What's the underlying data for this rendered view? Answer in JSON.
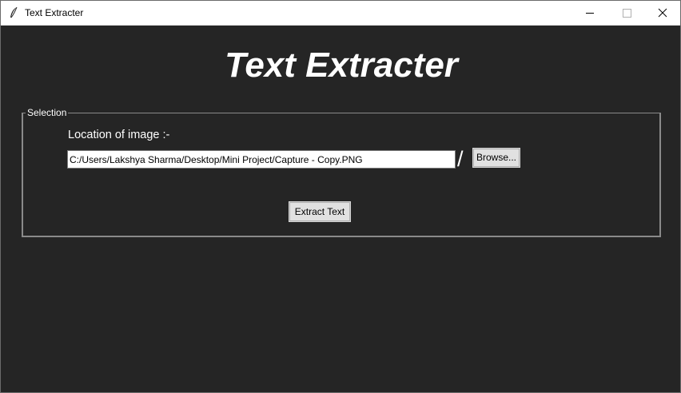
{
  "window": {
    "title": "Text Extracter",
    "icon": "feather-icon"
  },
  "heading": "Text Extracter",
  "selection": {
    "legend": "Selection",
    "location_label": "Location of image :-",
    "path_value": "C:/Users/Lakshya Sharma/Desktop/Mini Project/Capture - Copy.PNG",
    "separator": "/",
    "browse_label": "Browse...",
    "extract_label": "Extract Text"
  },
  "colors": {
    "background": "#252525",
    "text": "#ffffff",
    "button": "#e1e1e1",
    "frame": "#8a8a8a"
  }
}
